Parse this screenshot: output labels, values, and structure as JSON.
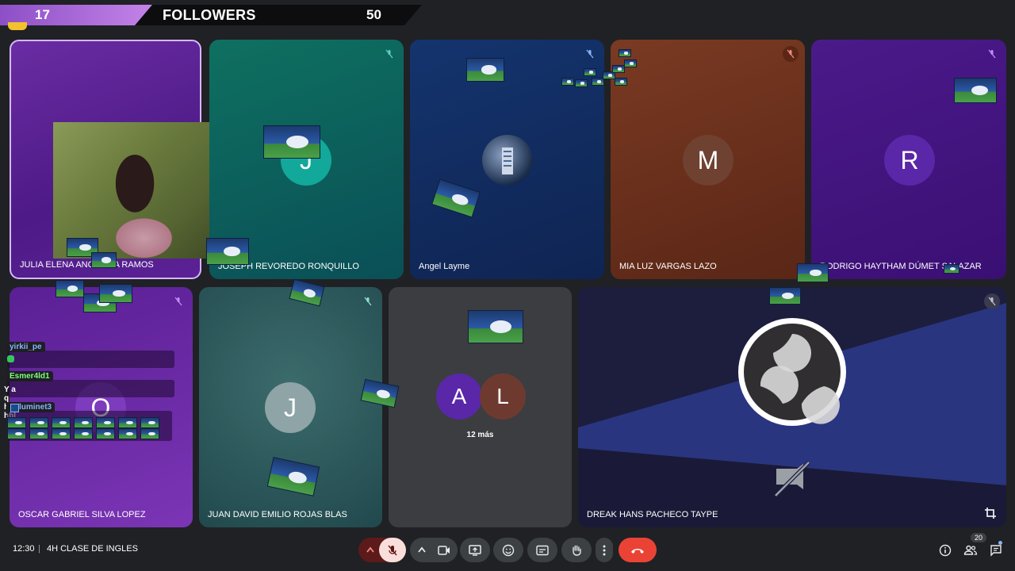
{
  "banner": {
    "count_left": "17",
    "label": "FOLLOWERS",
    "count_right": "50"
  },
  "tiles": [
    {
      "name": "JULIA ELENA ANCAJIMA RAMOS"
    },
    {
      "name": "JOSEPH REVOREDO RONQUILLO",
      "initial": "J"
    },
    {
      "name": "Angel Layme"
    },
    {
      "name": "MIA LUZ VARGAS LAZO",
      "initial": "M"
    },
    {
      "name": "RODRIGO HAYTHAM DÚMET SALAZAR",
      "initial": "R"
    },
    {
      "name": "OSCAR GABRIEL SILVA LOPEZ",
      "initial": "O"
    },
    {
      "name": "JUAN DAVID EMILIO ROJAS BLAS",
      "initial": "J"
    },
    {
      "initials": [
        "A",
        "L"
      ],
      "more": "12 más"
    },
    {
      "name": "DREAK HANS PACHECO TAYPE"
    }
  ],
  "chat": {
    "users": [
      {
        "name": "yirkii_pe",
        "message": ""
      },
      {
        "name": "Esmer4ld1",
        "message": "Y a q hora hbl"
      },
      {
        "name": "luminet3",
        "message": ""
      }
    ]
  },
  "meeting": {
    "time": "12:30",
    "title": "4H CLASE DE INGLES"
  },
  "people_count": "20",
  "colors": {
    "banner_accent": "#c383e8",
    "end_call": "#ea4335",
    "mic_muted_bg": "#f9dedc",
    "avatar_j_teal": "#12a89a",
    "avatar_r_purple": "#5a27a8"
  }
}
